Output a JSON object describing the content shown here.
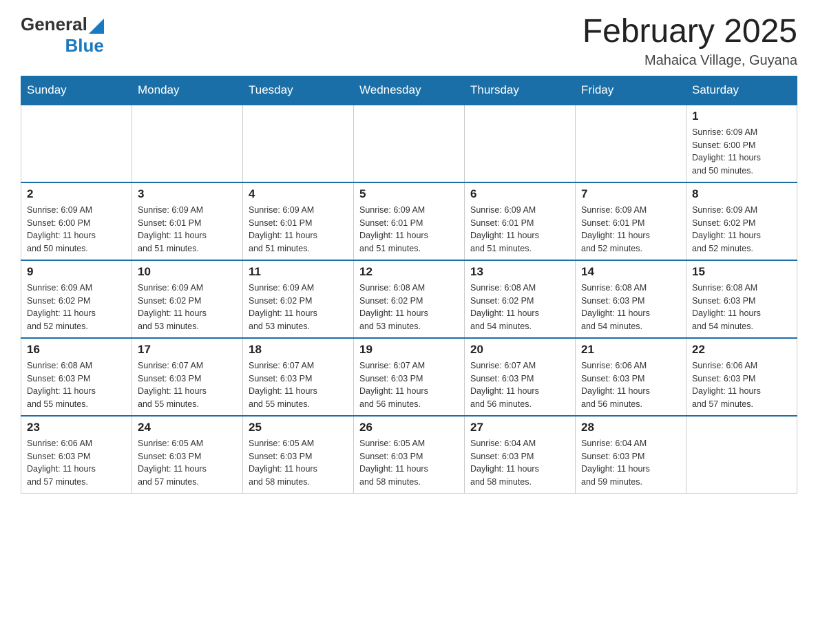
{
  "header": {
    "logo_general": "General",
    "logo_blue": "Blue",
    "month_title": "February 2025",
    "location": "Mahaica Village, Guyana"
  },
  "days_of_week": [
    "Sunday",
    "Monday",
    "Tuesday",
    "Wednesday",
    "Thursday",
    "Friday",
    "Saturday"
  ],
  "weeks": [
    {
      "days": [
        {
          "number": "",
          "info": ""
        },
        {
          "number": "",
          "info": ""
        },
        {
          "number": "",
          "info": ""
        },
        {
          "number": "",
          "info": ""
        },
        {
          "number": "",
          "info": ""
        },
        {
          "number": "",
          "info": ""
        },
        {
          "number": "1",
          "info": "Sunrise: 6:09 AM\nSunset: 6:00 PM\nDaylight: 11 hours\nand 50 minutes."
        }
      ]
    },
    {
      "days": [
        {
          "number": "2",
          "info": "Sunrise: 6:09 AM\nSunset: 6:00 PM\nDaylight: 11 hours\nand 50 minutes."
        },
        {
          "number": "3",
          "info": "Sunrise: 6:09 AM\nSunset: 6:01 PM\nDaylight: 11 hours\nand 51 minutes."
        },
        {
          "number": "4",
          "info": "Sunrise: 6:09 AM\nSunset: 6:01 PM\nDaylight: 11 hours\nand 51 minutes."
        },
        {
          "number": "5",
          "info": "Sunrise: 6:09 AM\nSunset: 6:01 PM\nDaylight: 11 hours\nand 51 minutes."
        },
        {
          "number": "6",
          "info": "Sunrise: 6:09 AM\nSunset: 6:01 PM\nDaylight: 11 hours\nand 51 minutes."
        },
        {
          "number": "7",
          "info": "Sunrise: 6:09 AM\nSunset: 6:01 PM\nDaylight: 11 hours\nand 52 minutes."
        },
        {
          "number": "8",
          "info": "Sunrise: 6:09 AM\nSunset: 6:02 PM\nDaylight: 11 hours\nand 52 minutes."
        }
      ]
    },
    {
      "days": [
        {
          "number": "9",
          "info": "Sunrise: 6:09 AM\nSunset: 6:02 PM\nDaylight: 11 hours\nand 52 minutes."
        },
        {
          "number": "10",
          "info": "Sunrise: 6:09 AM\nSunset: 6:02 PM\nDaylight: 11 hours\nand 53 minutes."
        },
        {
          "number": "11",
          "info": "Sunrise: 6:09 AM\nSunset: 6:02 PM\nDaylight: 11 hours\nand 53 minutes."
        },
        {
          "number": "12",
          "info": "Sunrise: 6:08 AM\nSunset: 6:02 PM\nDaylight: 11 hours\nand 53 minutes."
        },
        {
          "number": "13",
          "info": "Sunrise: 6:08 AM\nSunset: 6:02 PM\nDaylight: 11 hours\nand 54 minutes."
        },
        {
          "number": "14",
          "info": "Sunrise: 6:08 AM\nSunset: 6:03 PM\nDaylight: 11 hours\nand 54 minutes."
        },
        {
          "number": "15",
          "info": "Sunrise: 6:08 AM\nSunset: 6:03 PM\nDaylight: 11 hours\nand 54 minutes."
        }
      ]
    },
    {
      "days": [
        {
          "number": "16",
          "info": "Sunrise: 6:08 AM\nSunset: 6:03 PM\nDaylight: 11 hours\nand 55 minutes."
        },
        {
          "number": "17",
          "info": "Sunrise: 6:07 AM\nSunset: 6:03 PM\nDaylight: 11 hours\nand 55 minutes."
        },
        {
          "number": "18",
          "info": "Sunrise: 6:07 AM\nSunset: 6:03 PM\nDaylight: 11 hours\nand 55 minutes."
        },
        {
          "number": "19",
          "info": "Sunrise: 6:07 AM\nSunset: 6:03 PM\nDaylight: 11 hours\nand 56 minutes."
        },
        {
          "number": "20",
          "info": "Sunrise: 6:07 AM\nSunset: 6:03 PM\nDaylight: 11 hours\nand 56 minutes."
        },
        {
          "number": "21",
          "info": "Sunrise: 6:06 AM\nSunset: 6:03 PM\nDaylight: 11 hours\nand 56 minutes."
        },
        {
          "number": "22",
          "info": "Sunrise: 6:06 AM\nSunset: 6:03 PM\nDaylight: 11 hours\nand 57 minutes."
        }
      ]
    },
    {
      "days": [
        {
          "number": "23",
          "info": "Sunrise: 6:06 AM\nSunset: 6:03 PM\nDaylight: 11 hours\nand 57 minutes."
        },
        {
          "number": "24",
          "info": "Sunrise: 6:05 AM\nSunset: 6:03 PM\nDaylight: 11 hours\nand 57 minutes."
        },
        {
          "number": "25",
          "info": "Sunrise: 6:05 AM\nSunset: 6:03 PM\nDaylight: 11 hours\nand 58 minutes."
        },
        {
          "number": "26",
          "info": "Sunrise: 6:05 AM\nSunset: 6:03 PM\nDaylight: 11 hours\nand 58 minutes."
        },
        {
          "number": "27",
          "info": "Sunrise: 6:04 AM\nSunset: 6:03 PM\nDaylight: 11 hours\nand 58 minutes."
        },
        {
          "number": "28",
          "info": "Sunrise: 6:04 AM\nSunset: 6:03 PM\nDaylight: 11 hours\nand 59 minutes."
        },
        {
          "number": "",
          "info": ""
        }
      ]
    }
  ]
}
